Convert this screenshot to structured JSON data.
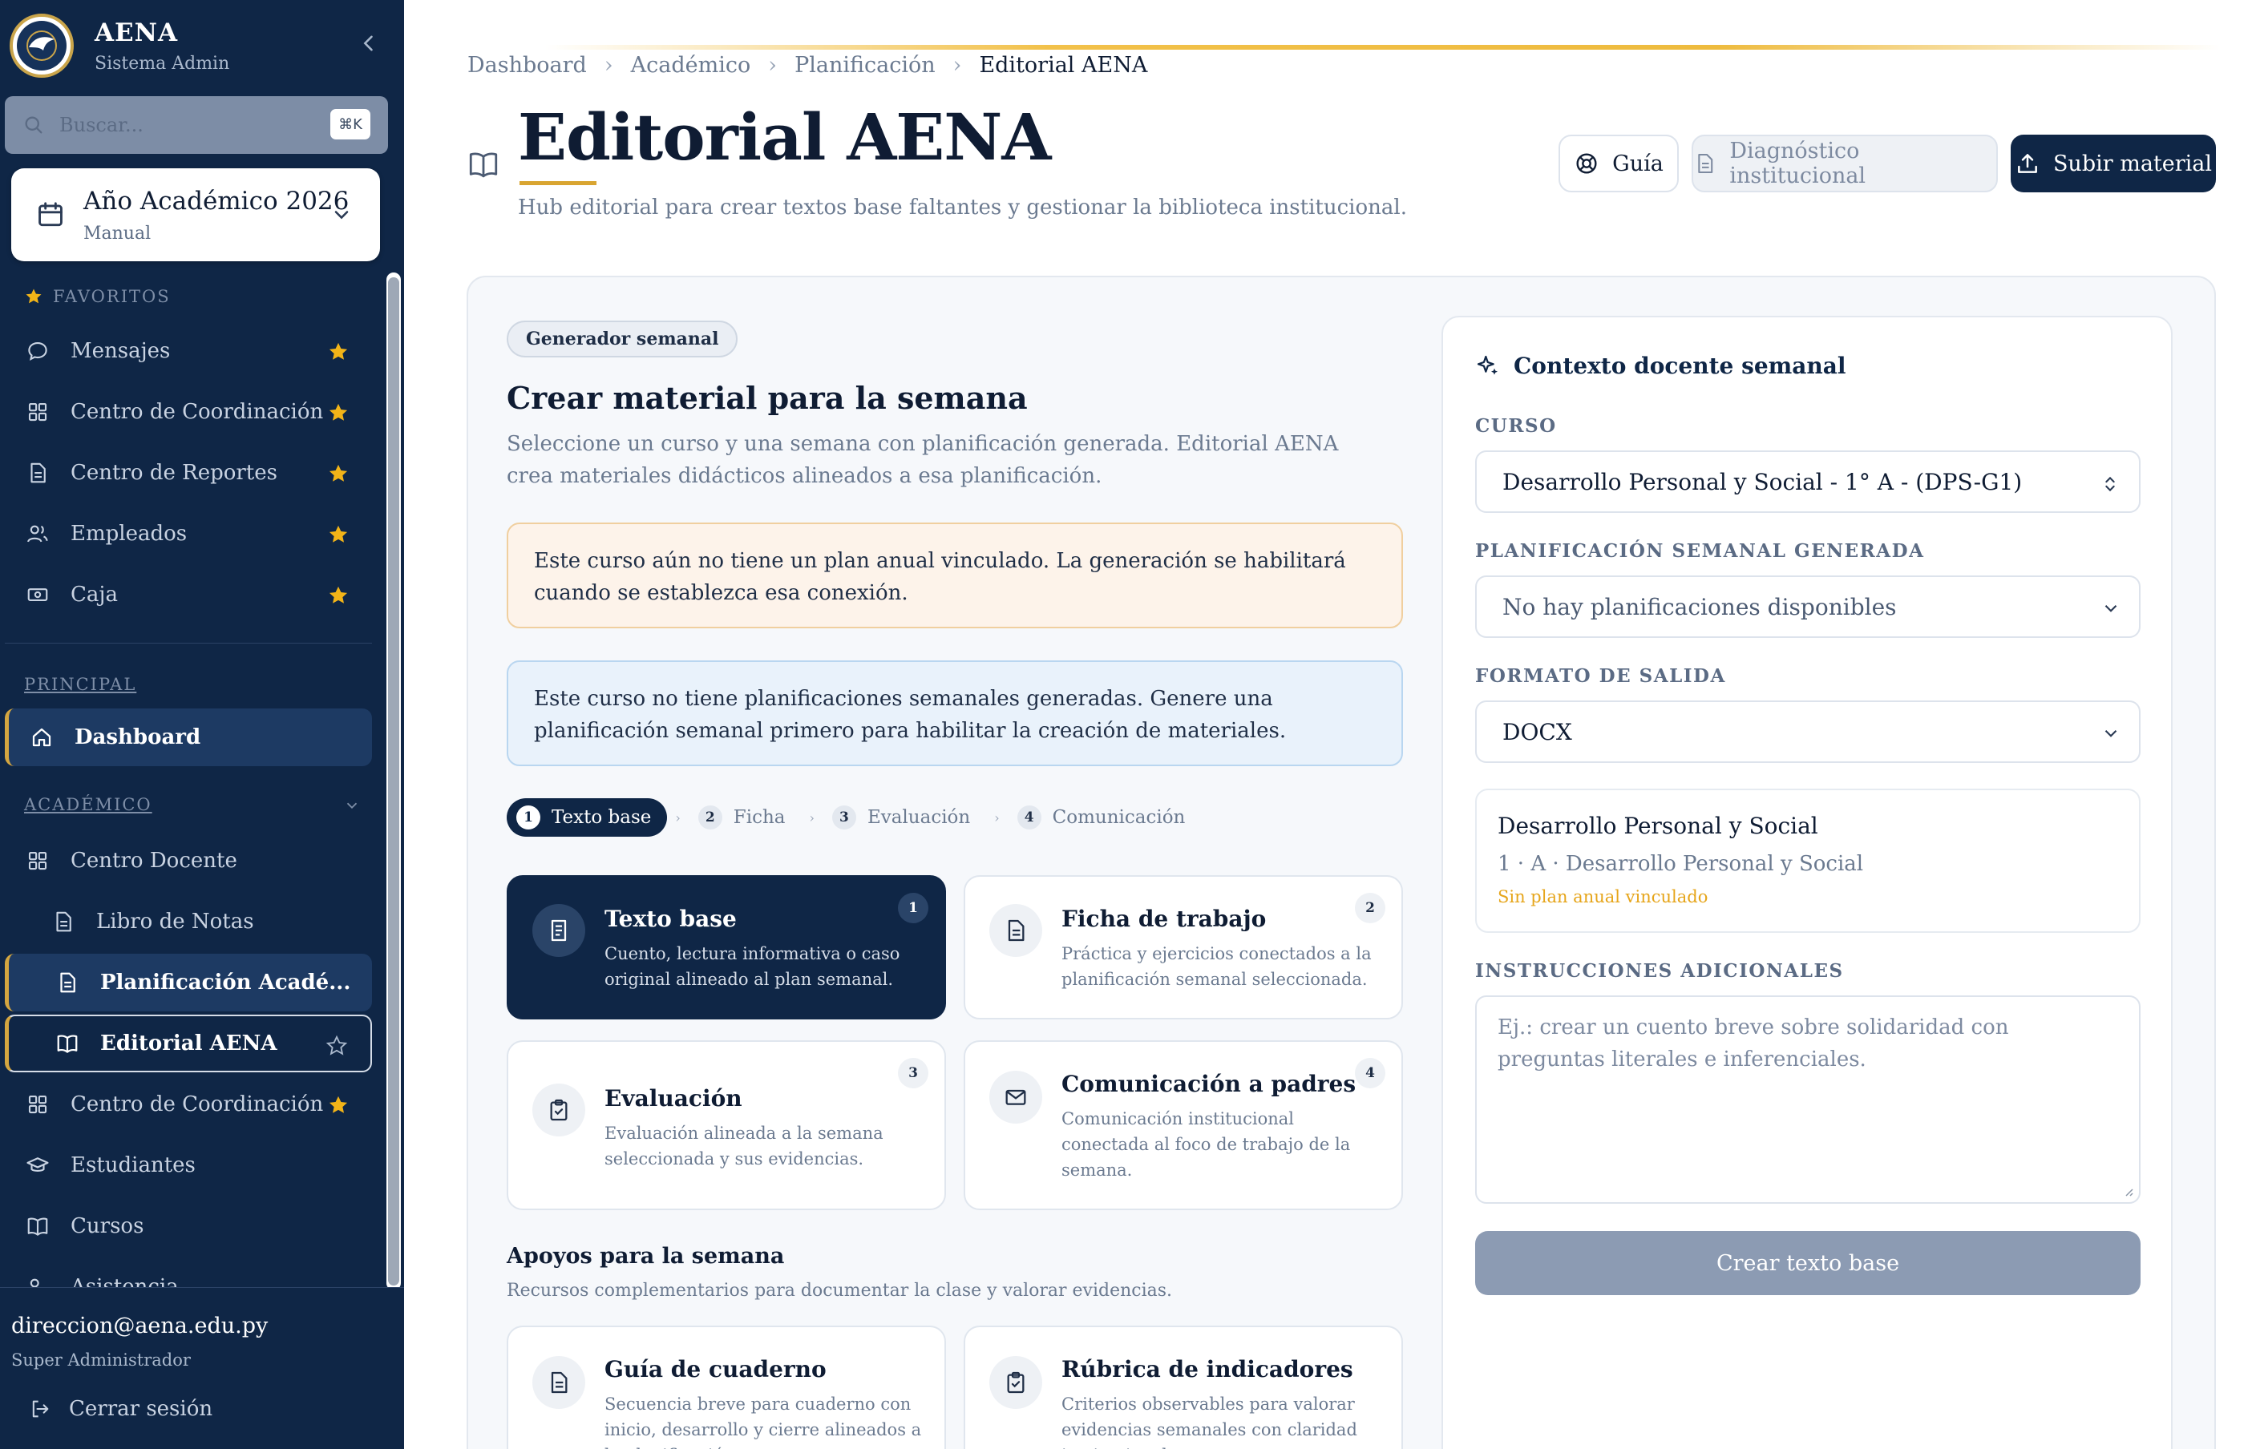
{
  "sidebar": {
    "brand": {
      "name": "AENA",
      "subtitle": "Sistema Admin"
    },
    "search": {
      "placeholder": "Buscar...",
      "shortcut": "⌘K"
    },
    "year": {
      "title": "Año Académico 2026",
      "mode": "Manual"
    },
    "favorites_label": "FAVORITOS",
    "favorites": [
      {
        "label": "Mensajes",
        "icon": "message-icon"
      },
      {
        "label": "Centro de Coordinación",
        "icon": "grid-icon"
      },
      {
        "label": "Centro de Reportes",
        "icon": "document-icon"
      },
      {
        "label": "Empleados",
        "icon": "users-icon"
      },
      {
        "label": "Caja",
        "icon": "cash-icon"
      }
    ],
    "principal_label": "PRINCIPAL",
    "principal": [
      {
        "label": "Dashboard",
        "icon": "home-icon"
      }
    ],
    "academico_label": "ACADÉMICO",
    "academico": [
      {
        "label": "Centro Docente"
      },
      {
        "label": "Libro de Notas"
      },
      {
        "label": "Planificación Acadé..."
      },
      {
        "label": "Editorial AENA"
      },
      {
        "label": "Centro de Coordinación"
      },
      {
        "label": "Estudiantes"
      },
      {
        "label": "Cursos"
      },
      {
        "label": "Asistencia"
      }
    ],
    "user": {
      "email": "direccion@aena.edu.py",
      "role": "Super Administrador"
    },
    "logout_label": "Cerrar sesión"
  },
  "breadcrumb": [
    "Dashboard",
    "Académico",
    "Planificación",
    "Editorial AENA"
  ],
  "header": {
    "title": "Editorial AENA",
    "subtitle": "Hub editorial para crear textos base faltantes y gestionar la biblioteca institucional.",
    "buttons": {
      "guide": "Guía",
      "diagnostic": "Diagnóstico institucional",
      "upload": "Subir material"
    }
  },
  "generator": {
    "badge": "Generador semanal",
    "title": "Crear material para la semana",
    "description": "Seleccione un curso y una semana con planificación generada. Editorial AENA crea materiales didácticos alineados a esa planificación.",
    "alert_warning": "Este curso aún no tiene un plan anual vinculado. La generación se habilitará cuando se establezca esa conexión.",
    "alert_info": "Este curso no tiene planificaciones semanales generadas. Genere una planificación semanal primero para habilitar la creación de materiales.",
    "steps": [
      {
        "num": "1",
        "label": "Texto base"
      },
      {
        "num": "2",
        "label": "Ficha"
      },
      {
        "num": "3",
        "label": "Evaluación"
      },
      {
        "num": "4",
        "label": "Comunicación"
      }
    ],
    "cards": [
      {
        "num": "1",
        "title": "Texto base",
        "desc": "Cuento, lectura informativa o caso original alineado al plan semanal.",
        "icon": "document-icon"
      },
      {
        "num": "2",
        "title": "Ficha de trabajo",
        "desc": "Práctica y ejercicios conectados a la planificación semanal seleccionada.",
        "icon": "document-icon"
      },
      {
        "num": "3",
        "title": "Evaluación",
        "desc": "Evaluación alineada a la semana seleccionada y sus evidencias.",
        "icon": "clipboard-check-icon"
      },
      {
        "num": "4",
        "title": "Comunicación a padres",
        "desc": "Comunicación institucional conectada al foco de trabajo de la semana.",
        "icon": "mail-icon"
      }
    ],
    "supports_title": "Apoyos para la semana",
    "supports_desc": "Recursos complementarios para documentar la clase y valorar evidencias.",
    "supports": [
      {
        "title": "Guía de cuaderno",
        "desc": "Secuencia breve para cuaderno con inicio, desarrollo y cierre alineados a la planificación.",
        "icon": "document-icon"
      },
      {
        "title": "Rúbrica de indicadores",
        "desc": "Criterios observables para valorar evidencias semanales con claridad institucional.",
        "icon": "clipboard-check-icon"
      }
    ]
  },
  "context": {
    "title": "Contexto docente semanal",
    "course_label": "CURSO",
    "course_value": "Desarrollo Personal y Social - 1° A - (DPS-G1)",
    "plan_label": "PLANIFICACIÓN SEMANAL GENERADA",
    "plan_value": "No hay planificaciones disponibles",
    "format_label": "FORMATO DE SALIDA",
    "format_value": "DOCX",
    "summary": {
      "subject": "Desarrollo Personal y Social",
      "detail": "1 · A · Desarrollo Personal y Social",
      "status": "Sin plan anual vinculado"
    },
    "instructions_label": "INSTRUCCIONES ADICIONALES",
    "instructions_placeholder": "Ej.: crear un cuento breve sobre solidaridad con preguntas literales e inferenciales.",
    "submit": "Crear texto base"
  },
  "colors": {
    "navy": "#0f2646",
    "gold": "#d9a531",
    "star": "#f2b418",
    "status_warning": "#e6a51a"
  }
}
